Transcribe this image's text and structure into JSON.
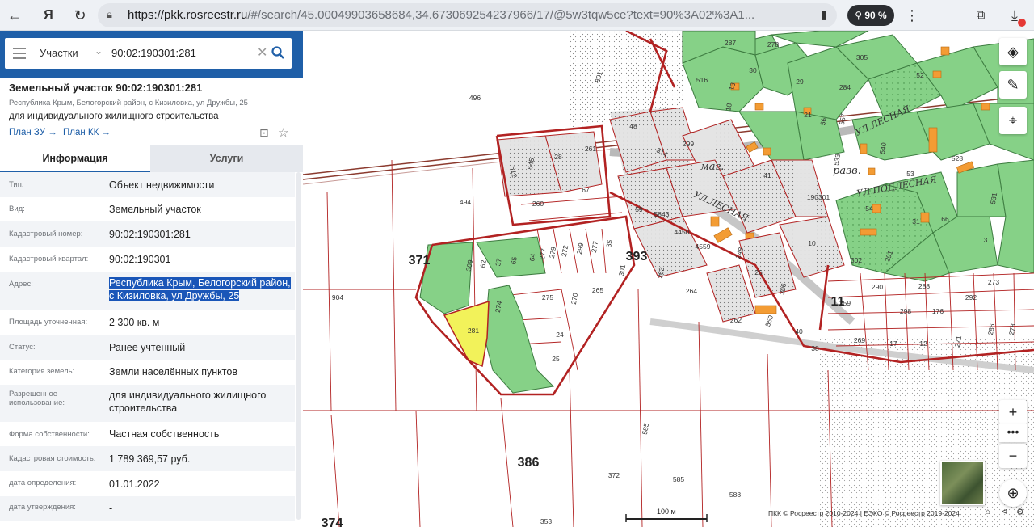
{
  "browser": {
    "url_host": "https://pkk.rosreestr.ru",
    "url_rest": "/#/search/45.00049903658684,34.673069254237966/17/@5w3tqw5ce?text=90%3A02%3A1...",
    "zoom": "90 %"
  },
  "search": {
    "type_label": "Участки",
    "query": "90:02:190301:281"
  },
  "parcel": {
    "title": "Земельный участок 90:02:190301:281",
    "address_short": "Республика Крым, Белогорский район, с Кизиловка, ул Дружбы, 25",
    "purpose": "для индивидуального жилищного строительства",
    "plan_zu": "План ЗУ →",
    "plan_kk": "План КК →"
  },
  "tabs": {
    "info": "Информация",
    "services": "Услуги"
  },
  "fields": [
    {
      "key": "Тип:",
      "value": "Объект недвижимости"
    },
    {
      "key": "Вид:",
      "value": "Земельный участок"
    },
    {
      "key": "Кадастровый номер:",
      "value": "90:02:190301:281"
    },
    {
      "key": "Кадастровый квартал:",
      "value": "90:02:190301"
    },
    {
      "key": "Адрес:",
      "value": "Республика Крым, Белогорский район, с Кизиловка, ул Дружбы, 25"
    },
    {
      "key": "Площадь уточненная:",
      "value": "2 300 кв. м"
    },
    {
      "key": "Статус:",
      "value": "Ранее учтенный"
    },
    {
      "key": "Категория земель:",
      "value": "Земли населённых пунктов"
    },
    {
      "key": "Разрешенное использование:",
      "value": "для индивидуального жилищного строительства"
    },
    {
      "key": "Форма собственности:",
      "value": "Частная собственность"
    },
    {
      "key": "Кадастровая стоимость:",
      "value": "1 789 369,57 руб."
    },
    {
      "key": "дата определения:",
      "value": "01.01.2022"
    },
    {
      "key": "дата утверждения:",
      "value": "-"
    }
  ],
  "map": {
    "labels": [
      "496",
      "494",
      "904",
      "891",
      "287",
      "278",
      "516",
      "13",
      "30",
      "29",
      "305",
      "284",
      "52",
      "18",
      "21",
      "56",
      "557",
      "48",
      "299",
      "314",
      "545",
      "28",
      "261",
      "512",
      "260",
      "67",
      "41",
      "190301",
      "533",
      "540",
      "53",
      "528",
      "54",
      "31",
      "66",
      "531",
      "3",
      "59",
      "5843",
      "4450",
      "4559",
      "248",
      "26",
      "306",
      "10",
      "302",
      "291",
      "371",
      "309",
      "62",
      "37",
      "65",
      "64",
      "277",
      "279",
      "272",
      "299",
      "277",
      "35",
      "393",
      "301",
      "263",
      "264",
      "275",
      "270",
      "265",
      "274",
      "281",
      "24",
      "25",
      "262",
      "559",
      "40",
      "38",
      "259",
      "290",
      "288",
      "273",
      "298",
      "176",
      "292",
      "286",
      "278",
      "269",
      "17",
      "12",
      "271",
      "386",
      "585",
      "372",
      "585",
      "588",
      "353",
      "374",
      "11",
      "маг.",
      "разв.",
      "УЛ.ЛЕСНАЯ",
      "УЛ.ЛЕСНАЯ",
      "УЛ.ПОДЛЕСНАЯ"
    ],
    "scale": "100 м",
    "copyright": "ПКК © Росреестр 2010-2024 | ЕЭКО © Росреестр 2019-2024"
  },
  "colors": {
    "header_blue": "#1f5fa8",
    "parcel_green": "#86d187",
    "selected_yellow": "#f2f25a",
    "boundary_red": "#b22222"
  }
}
